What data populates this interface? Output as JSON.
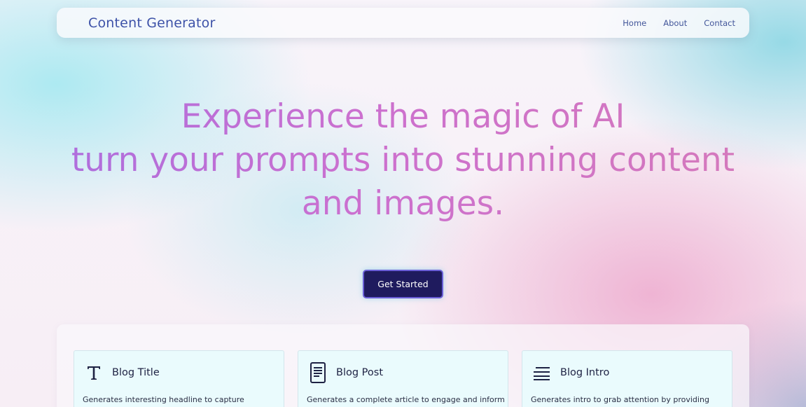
{
  "navbar": {
    "brand": "Content Generator",
    "links": [
      "Home",
      "About",
      "Contact"
    ]
  },
  "hero": {
    "lines": [
      "Experience the magic of AI",
      "turn your prompts into stunning content",
      "and images."
    ],
    "cta_label": "Get Started"
  },
  "cards": [
    {
      "icon": "text-t-icon",
      "title": "Blog Title",
      "description": "Generates interesting headline to capture"
    },
    {
      "icon": "document-icon",
      "title": "Blog Post",
      "description": "Generates a complete article to engage and inform"
    },
    {
      "icon": "lines-icon",
      "title": "Blog Intro",
      "description": "Generates intro to grab attention by providing"
    }
  ],
  "colors": {
    "brand": "#3d52a8",
    "cta_bg": "#1f1b5e",
    "cta_border": "#6a5ed6",
    "hero_gradient_start": "#a86ee0",
    "hero_gradient_end": "#d67ab9",
    "card_bg": "#eafbfd"
  }
}
